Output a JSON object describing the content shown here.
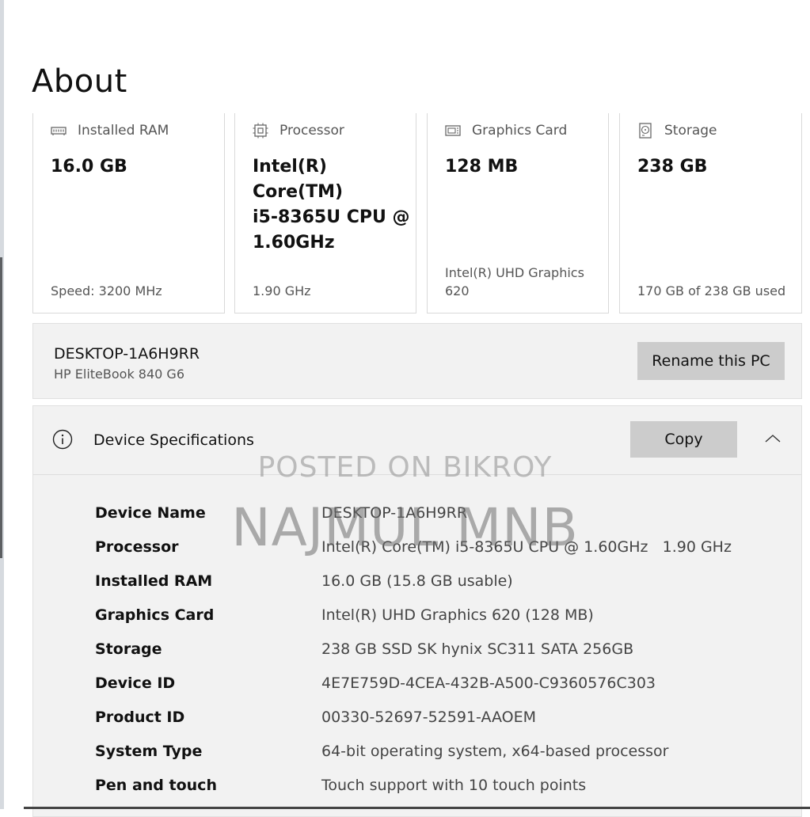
{
  "page": {
    "title": "About"
  },
  "cards": [
    {
      "icon": "ram-icon",
      "label": "Installed RAM",
      "value": "16.0 GB",
      "footer": "Speed: 3200 MHz"
    },
    {
      "icon": "processor-icon",
      "label": "Processor",
      "value": "Intel(R) Core(TM)\ni5-8365U CPU @\n1.60GHz",
      "footer": "1.90 GHz"
    },
    {
      "icon": "graphics-card-icon",
      "label": "Graphics Card",
      "value": "128 MB",
      "footer": "Intel(R) UHD Graphics\n620"
    },
    {
      "icon": "storage-icon",
      "label": "Storage",
      "value": "238 GB",
      "footer": "170 GB of 238 GB used"
    }
  ],
  "pc": {
    "name": "DESKTOP-1A6H9RR",
    "model": "HP EliteBook 840 G6",
    "rename_label": "Rename this PC"
  },
  "specs": {
    "title": "Device Specifications",
    "copy_label": "Copy",
    "rows": [
      {
        "label": "Device Name",
        "value": "DESKTOP-1A6H9RR"
      },
      {
        "label": "Processor",
        "value": "Intel(R) Core(TM) i5-8365U CPU @ 1.60GHz   1.90 GHz"
      },
      {
        "label": "Installed RAM",
        "value": "16.0 GB (15.8 GB usable)"
      },
      {
        "label": "Graphics Card",
        "value": "Intel(R) UHD Graphics 620 (128 MB)"
      },
      {
        "label": "Storage",
        "value": "238 GB SSD SK hynix SC311 SATA 256GB"
      },
      {
        "label": "Device ID",
        "value": "4E7E759D-4CEA-432B-A500-C9360576C303"
      },
      {
        "label": "Product ID",
        "value": "00330-52697-52591-AAOEM"
      },
      {
        "label": "System Type",
        "value": "64-bit operating system, x64-based processor"
      },
      {
        "label": "Pen and touch",
        "value": "Touch support with 10 touch points"
      }
    ]
  },
  "watermark": {
    "line1": "POSTED ON BIKROY",
    "line2": "NAJMUL MNB"
  }
}
